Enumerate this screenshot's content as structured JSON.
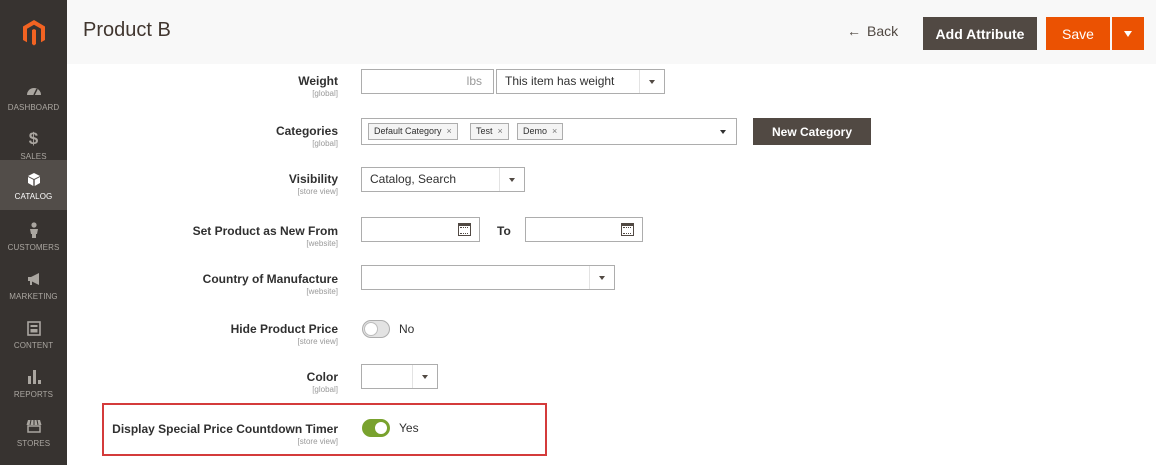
{
  "sidebar": {
    "logo_icon": "magento-logo-icon",
    "items": [
      {
        "label": "DASHBOARD",
        "icon": "dashboard-icon",
        "active": false
      },
      {
        "label": "SALES",
        "icon": "dollar-icon",
        "active": false
      },
      {
        "label": "CATALOG",
        "icon": "box-icon",
        "active": true
      },
      {
        "label": "CUSTOMERS",
        "icon": "person-icon",
        "active": false
      },
      {
        "label": "MARKETING",
        "icon": "megaphone-icon",
        "active": false
      },
      {
        "label": "CONTENT",
        "icon": "layout-icon",
        "active": false
      },
      {
        "label": "REPORTS",
        "icon": "bar-chart-icon",
        "active": false
      },
      {
        "label": "STORES",
        "icon": "store-icon",
        "active": false
      }
    ]
  },
  "header": {
    "title": "Product B",
    "back_label": "Back",
    "add_attribute_label": "Add Attribute",
    "save_label": "Save"
  },
  "form": {
    "weight": {
      "label": "Weight",
      "scope": "[global]",
      "value": "",
      "unit": "lbs",
      "select_value": "This item has weight"
    },
    "categories": {
      "label": "Categories",
      "scope": "[global]",
      "tags": [
        "Default Category",
        "Test",
        "Demo"
      ],
      "new_category_label": "New Category"
    },
    "visibility": {
      "label": "Visibility",
      "scope": "[store view]",
      "value": "Catalog, Search"
    },
    "new_from": {
      "label": "Set Product as New From",
      "scope": "[website]",
      "from_value": "",
      "to_label": "To",
      "to_value": ""
    },
    "country": {
      "label": "Country of Manufacture",
      "scope": "[website]",
      "value": ""
    },
    "hide_price": {
      "label": "Hide Product Price",
      "scope": "[store view]",
      "state": "No",
      "on": false
    },
    "color": {
      "label": "Color",
      "scope": "[global]",
      "value": ""
    },
    "countdown": {
      "label": "Display Special Price Countdown Timer",
      "scope": "[store view]",
      "state": "Yes",
      "on": true
    }
  },
  "colors": {
    "accent": "#eb5202",
    "dark_button": "#514943",
    "sidebar": "#373330",
    "toggle_on": "#79a22e",
    "highlight": "#d43b3b"
  }
}
